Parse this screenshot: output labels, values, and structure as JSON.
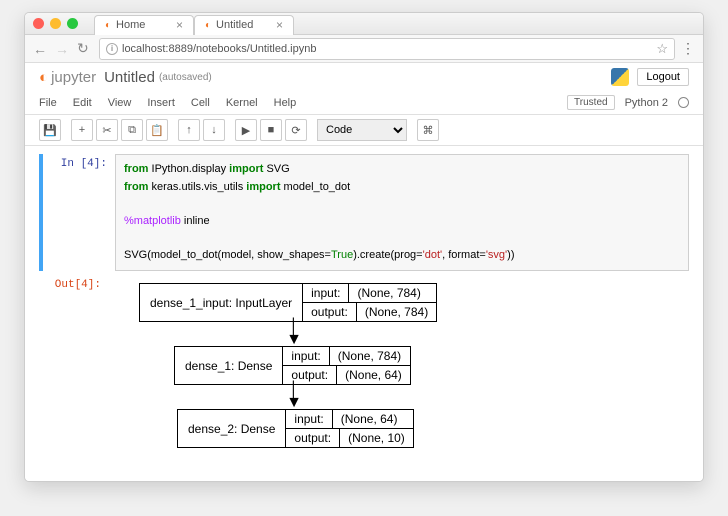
{
  "browser": {
    "tabs": [
      {
        "label": "Home"
      },
      {
        "label": "Untitled"
      }
    ],
    "url": "localhost:8889/notebooks/Untitled.ipynb"
  },
  "header": {
    "brand": "jupyter",
    "title": "Untitled",
    "autosaved": "(autosaved)",
    "logout": "Logout"
  },
  "menubar": {
    "items": [
      "File",
      "Edit",
      "View",
      "Insert",
      "Cell",
      "Kernel",
      "Help"
    ],
    "trusted": "Trusted",
    "kernel": "Python 2"
  },
  "toolbar": {
    "celltype": "Code"
  },
  "cell": {
    "in_prompt": "In [4]:",
    "out_prompt": "Out[4]:",
    "code": {
      "line1a": "from",
      "line1b": " IPython.display ",
      "line1c": "import",
      "line1d": " SVG",
      "line2a": "from",
      "line2b": " keras.utils.vis_utils ",
      "line2c": "import",
      "line2d": " model_to_dot",
      "line3a": "%matplotlib",
      "line3b": " inline",
      "line4a": "SVG(model_to_dot(model, show_shapes=",
      "line4b": "True",
      "line4c": ").create(prog=",
      "line4d": "'dot'",
      "line4e": ", format=",
      "line4f": "'svg'",
      "line4g": "))"
    }
  },
  "diagram": {
    "layers": [
      {
        "name": "dense_1_input: InputLayer",
        "input_label": "input:",
        "input_shape": "(None, 784)",
        "output_label": "output:",
        "output_shape": "(None, 784)"
      },
      {
        "name": "dense_1: Dense",
        "input_label": "input:",
        "input_shape": "(None, 784)",
        "output_label": "output:",
        "output_shape": "(None, 64)"
      },
      {
        "name": "dense_2: Dense",
        "input_label": "input:",
        "input_shape": "(None, 64)",
        "output_label": "output:",
        "output_shape": "(None, 10)"
      }
    ]
  }
}
